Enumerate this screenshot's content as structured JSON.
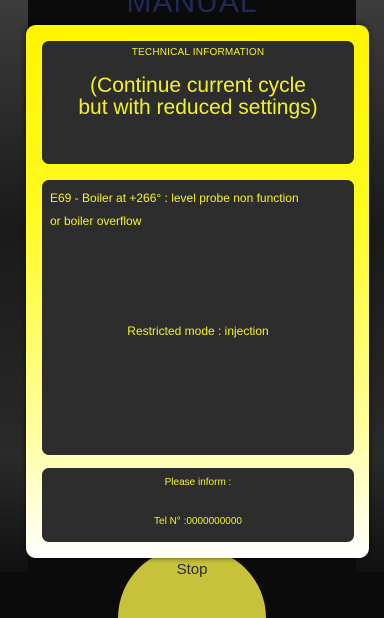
{
  "background": {
    "title": "MANUAL",
    "stop_label": "Stop"
  },
  "modal": {
    "technical_header": "TECHNICAL INFORMATION",
    "technical_line1": "(Continue current cycle",
    "technical_line2": "but with reduced settings)",
    "error_line1": "E69 - Boiler at +266° : level probe non function",
    "error_line2": "or boiler overflow",
    "restricted_mode": "Restricted mode : injection",
    "please_inform": "Please inform :",
    "tel_label": "Tel N° :",
    "tel_number": "0000000000"
  },
  "colors": {
    "accent_yellow": "#fff500",
    "panel_bg": "#2d2d2d",
    "text_yellow": "#f3f027"
  }
}
